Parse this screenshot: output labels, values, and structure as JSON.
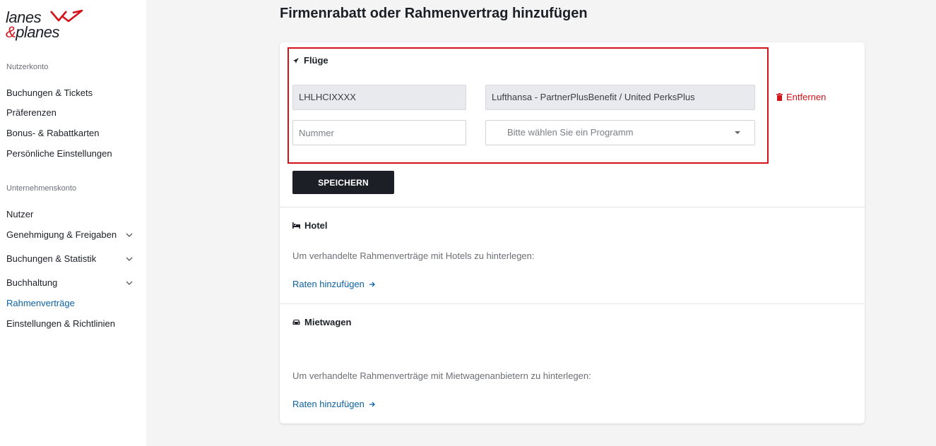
{
  "logo": {
    "line1": "lanes",
    "amp": "&",
    "line2": "planes"
  },
  "sidebar": {
    "user_section": "Nutzerkonto",
    "user_items": [
      {
        "label": "Buchungen & Tickets"
      },
      {
        "label": "Präferenzen"
      },
      {
        "label": "Bonus- & Rabattkarten"
      },
      {
        "label": "Persönliche Einstellungen"
      }
    ],
    "company_section": "Unternehmenskonto",
    "company_items": [
      {
        "label": "Nutzer"
      },
      {
        "label": "Genehmigung & Freigaben"
      },
      {
        "label": "Buchungen & Statistik"
      },
      {
        "label": "Buchhaltung"
      },
      {
        "label": "Rahmenverträge"
      },
      {
        "label": "Einstellungen & Richtlinien"
      }
    ]
  },
  "page": {
    "title": "Firmenrabatt oder Rahmenvertrag hinzufügen"
  },
  "flights": {
    "title": "Flüge",
    "code_value": "LHLHCIXXXX",
    "program_value": "Lufthansa - PartnerPlusBenefit / United PerksPlus",
    "number_placeholder": "Nummer",
    "program_placeholder": "Bitte wählen Sie ein Programm",
    "remove_label": "Entfernen",
    "save_label": "SPEICHERN"
  },
  "hotel": {
    "title": "Hotel",
    "description": "Um verhandelte Rahmenverträge mit Hotels zu hinterlegen:",
    "link_label": "Raten hinzufügen"
  },
  "car": {
    "title": "Mietwagen",
    "description": "Um verhandelte Rahmenverträge mit Mietwagenanbietern zu hinterlegen:",
    "link_label": "Raten hinzufügen"
  },
  "colors": {
    "brand_red": "#d4121a",
    "link_blue": "#0d62a3",
    "dark": "#1c1f26"
  }
}
